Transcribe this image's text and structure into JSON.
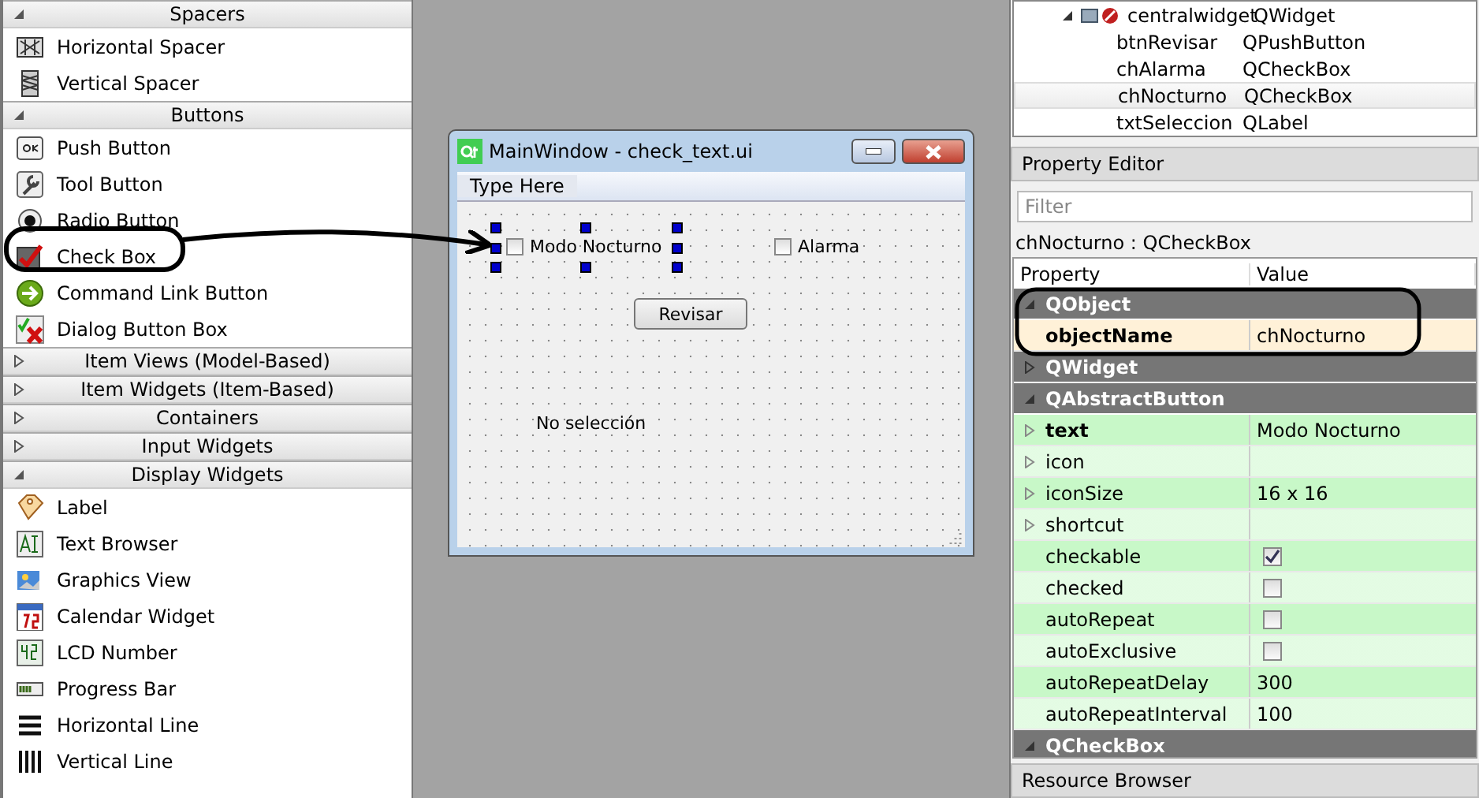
{
  "widget_box": {
    "sections": [
      {
        "title": "Spacers",
        "expanded": true,
        "items": [
          "Horizontal Spacer",
          "Vertical Spacer"
        ]
      },
      {
        "title": "Buttons",
        "expanded": true,
        "items": [
          "Push Button",
          "Tool Button",
          "Radio Button",
          "Check Box",
          "Command Link Button",
          "Dialog Button Box"
        ]
      },
      {
        "title": "Item Views (Model-Based)",
        "expanded": false
      },
      {
        "title": "Item Widgets (Item-Based)",
        "expanded": false
      },
      {
        "title": "Containers",
        "expanded": false
      },
      {
        "title": "Input Widgets",
        "expanded": false
      },
      {
        "title": "Display Widgets",
        "expanded": true,
        "items": [
          "Label",
          "Text Browser",
          "Graphics View",
          "Calendar Widget",
          "LCD Number",
          "Progress Bar",
          "Horizontal Line",
          "Vertical Line"
        ]
      }
    ]
  },
  "form_window": {
    "title": "MainWindow - check_text.ui",
    "menu": "Type Here",
    "widgets": [
      {
        "kind": "checkbox",
        "label": "Modo Nocturno",
        "checked": false,
        "selected": true
      },
      {
        "kind": "checkbox",
        "label": "Alarma",
        "checked": false,
        "selected": false
      },
      {
        "kind": "button",
        "label": "Revisar",
        "selected": false
      },
      {
        "kind": "label",
        "label": "No selección",
        "selected": false
      }
    ]
  },
  "object_inspector": {
    "rows": [
      {
        "name": "centralwidget",
        "class": "QWidget",
        "expanded": true,
        "selected": false,
        "children": [
          {
            "name": "btnRevisar",
            "class": "QPushButton",
            "selected": false
          },
          {
            "name": "chAlarma",
            "class": "QCheckBox",
            "selected": false
          },
          {
            "name": "chNocturno",
            "class": "QCheckBox",
            "selected": true
          },
          {
            "name": "txtSeleccion",
            "class": "QLabel",
            "selected": false
          }
        ]
      }
    ]
  },
  "property_editor": {
    "title": "Property Editor",
    "filter_placeholder": "Filter",
    "object": "chNocturno : QCheckBox",
    "columns": [
      "Property",
      "Value"
    ],
    "groups": [
      {
        "name": "QObject",
        "expanded": true,
        "color": "#fff1d8",
        "properties": [
          {
            "name": "objectName",
            "kind": "text",
            "value": "chNocturno",
            "modified": true,
            "expandable": false
          }
        ]
      },
      {
        "name": "QWidget",
        "expanded": false
      },
      {
        "name": "QAbstractButton",
        "expanded": true,
        "color": "#c8f8c8",
        "properties": [
          {
            "name": "text",
            "kind": "text",
            "value": "Modo Nocturno",
            "modified": true,
            "expandable": true
          },
          {
            "name": "icon",
            "kind": "text",
            "modified": false,
            "expandable": true
          },
          {
            "name": "iconSize",
            "kind": "text",
            "value": "16 x 16",
            "modified": false,
            "expandable": true
          },
          {
            "name": "shortcut",
            "kind": "text",
            "modified": false,
            "expandable": true
          },
          {
            "name": "checkable",
            "kind": "bool",
            "checked": true,
            "modified": false,
            "expandable": false
          },
          {
            "name": "checked",
            "kind": "bool",
            "checked": false,
            "modified": false,
            "expandable": false
          },
          {
            "name": "autoRepeat",
            "kind": "bool",
            "checked": false,
            "modified": false,
            "expandable": false
          },
          {
            "name": "autoExclusive",
            "kind": "bool",
            "checked": false,
            "modified": false,
            "expandable": false
          },
          {
            "name": "autoRepeatDelay",
            "kind": "text",
            "value": "300",
            "modified": false,
            "expandable": false
          },
          {
            "name": "autoRepeatInterval",
            "kind": "text",
            "value": "100",
            "modified": false,
            "expandable": false
          }
        ]
      },
      {
        "name": "QCheckBox",
        "expanded": true
      }
    ]
  },
  "resource_browser": {
    "title": "Resource Browser"
  }
}
